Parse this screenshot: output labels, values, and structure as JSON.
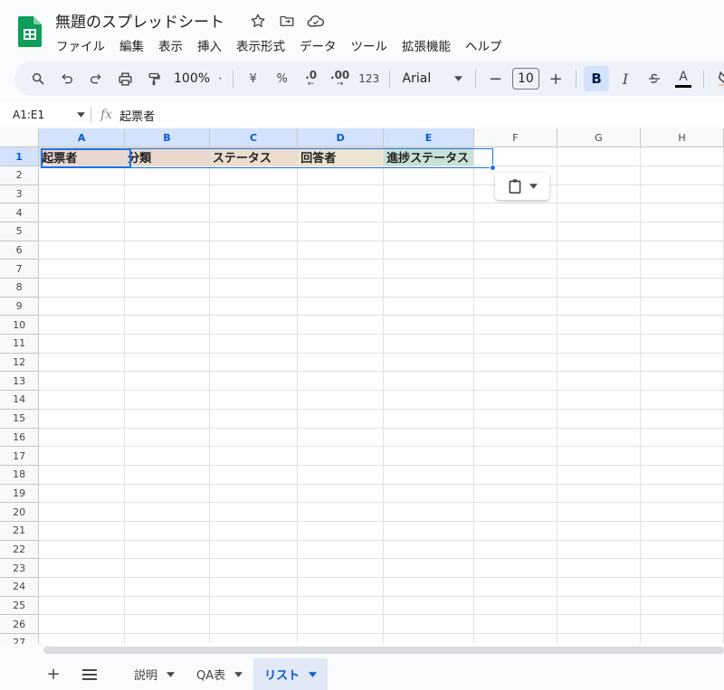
{
  "app": {
    "doc_title": "無題のスプレッドシート",
    "menu": [
      "ファイル",
      "編集",
      "表示",
      "挿入",
      "表示形式",
      "データ",
      "ツール",
      "拡張機能",
      "ヘルプ"
    ]
  },
  "toolbar": {
    "zoom": "100%",
    "currency": "¥",
    "percent": "%",
    "dec_decrease": ".0",
    "dec_increase": ".00",
    "number_format": "123",
    "font": "Arial",
    "font_size": "10",
    "bold": "B",
    "italic": "I",
    "text_color_letter": "A",
    "minus": "−",
    "plus": "+"
  },
  "formula": {
    "range": "A1:E1",
    "fx": "fx",
    "value": "起票者"
  },
  "grid": {
    "columns": [
      "A",
      "B",
      "C",
      "D",
      "E",
      "F",
      "G",
      "H"
    ],
    "row_count": 27,
    "header_row": [
      "起票者",
      "分類",
      "ステータス",
      "回答者",
      "進捗ステータス"
    ],
    "header_colors": [
      "#ead8d0",
      "#ead8d0",
      "#eddcce",
      "#ede4d1",
      "#c8e1d6"
    ]
  },
  "sheets": {
    "tabs": [
      {
        "label": "説明",
        "active": false
      },
      {
        "label": "QA表",
        "active": false
      },
      {
        "label": "リスト",
        "active": true
      }
    ]
  },
  "colors": {
    "accent": "#1a73e8",
    "sheets_green": "#0f9d58"
  }
}
